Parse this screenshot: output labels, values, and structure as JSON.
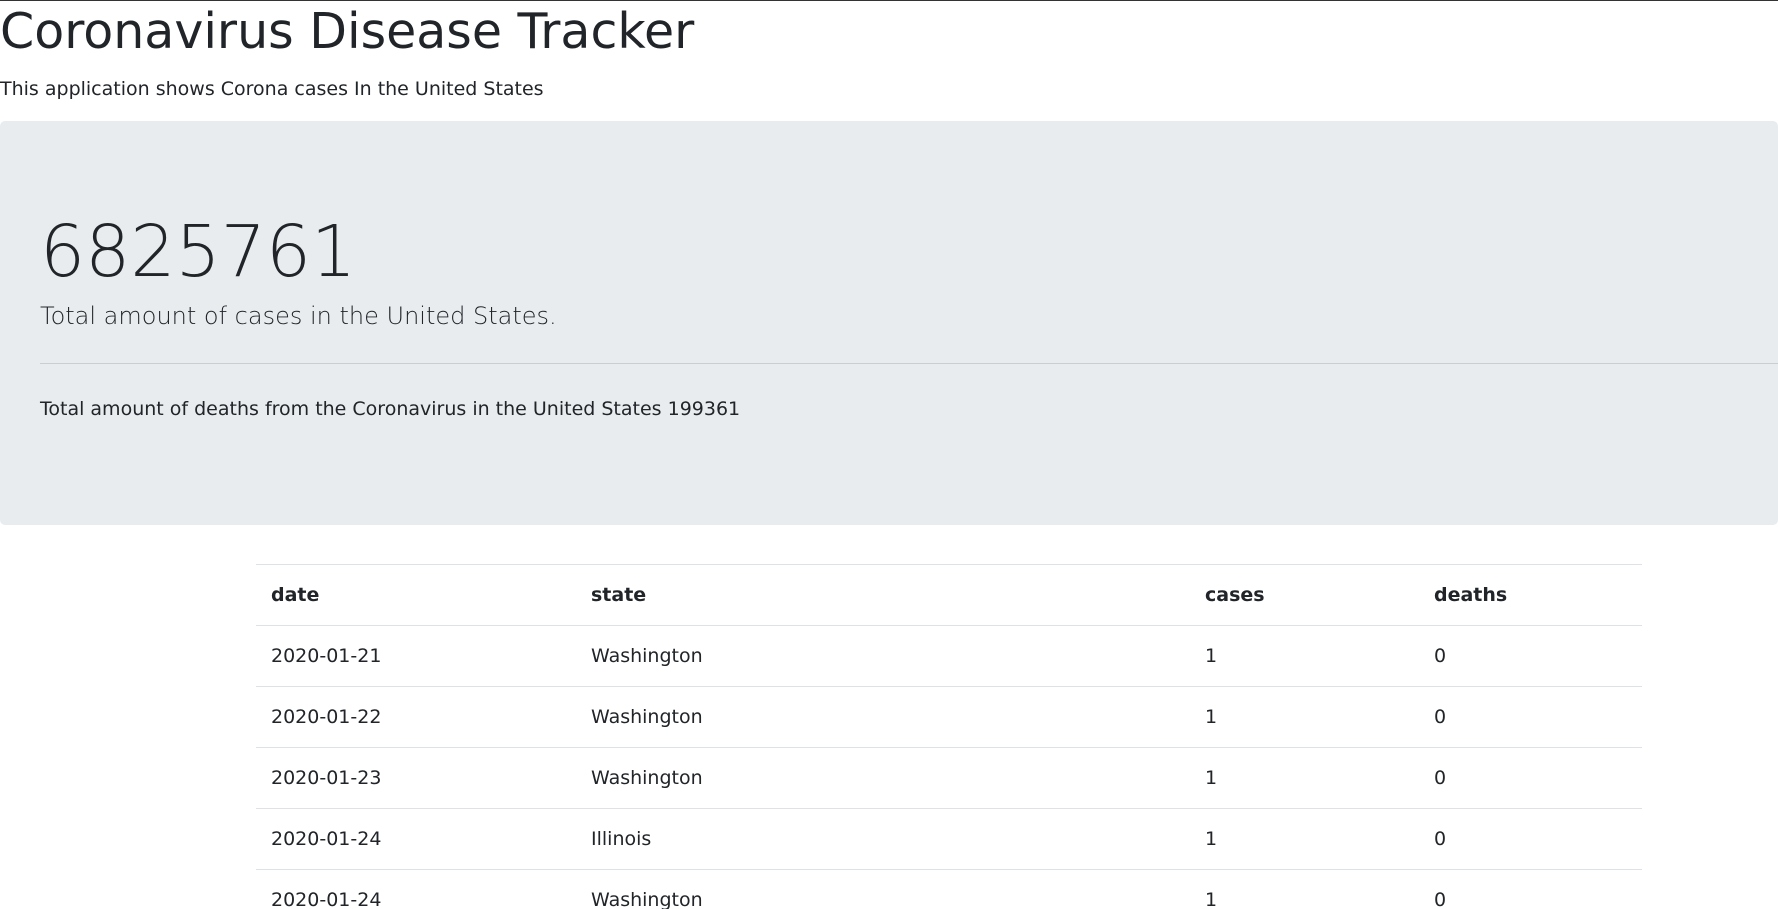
{
  "header": {
    "title": "Coronavirus Disease Tracker",
    "subtitle": "This application shows Corona cases In the United States"
  },
  "summary": {
    "total_cases": "6825761",
    "total_cases_label": "Total amount of cases in the United States.",
    "deaths_text": "Total amount of deaths from the Coronavirus in the United States 199361"
  },
  "table": {
    "columns": [
      "date",
      "state",
      "cases",
      "deaths"
    ],
    "rows": [
      [
        "2020-01-21",
        "Washington",
        "1",
        "0"
      ],
      [
        "2020-01-22",
        "Washington",
        "1",
        "0"
      ],
      [
        "2020-01-23",
        "Washington",
        "1",
        "0"
      ],
      [
        "2020-01-24",
        "Illinois",
        "1",
        "0"
      ],
      [
        "2020-01-24",
        "Washington",
        "1",
        "0"
      ]
    ]
  },
  "colors": {
    "jumbotron_bg": "#e9ecef",
    "text": "#212529",
    "border": "#dee2e6"
  }
}
